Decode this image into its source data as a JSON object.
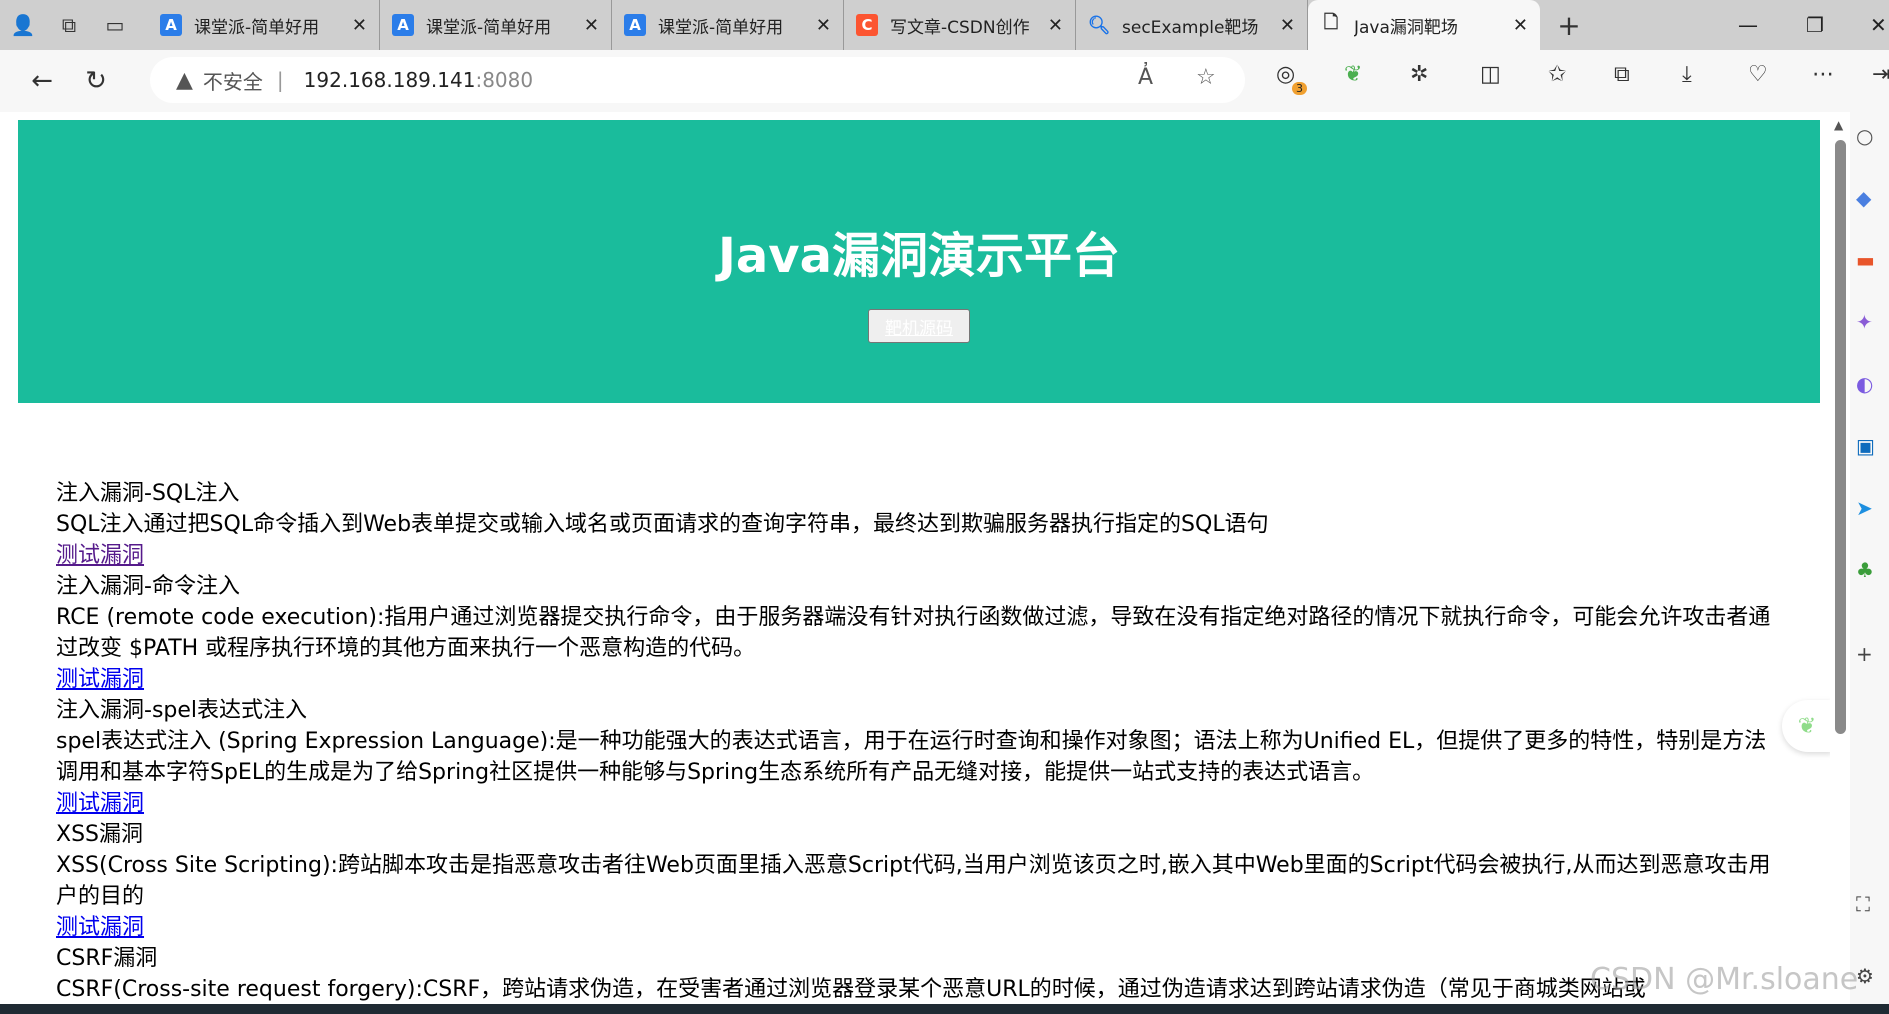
{
  "browser": {
    "tabs": [
      {
        "title": "课堂派-简单好用",
        "favicon": "A",
        "color": "#2b7de9"
      },
      {
        "title": "课堂派-简单好用",
        "favicon": "A",
        "color": "#2b7de9"
      },
      {
        "title": "课堂派-简单好用",
        "favicon": "A",
        "color": "#2b7de9"
      },
      {
        "title": "写文章-CSDN创作",
        "favicon": "C",
        "color": "#fc5531"
      },
      {
        "title": "secExample靶场",
        "favicon": "search-icon",
        "color": "#1a73e8"
      },
      {
        "title": "Java漏洞靶场",
        "favicon": "page-icon",
        "active": true
      }
    ],
    "address": {
      "security": "不安全",
      "host": "192.168.189.141",
      "port": ":8080"
    },
    "badge_count": "3"
  },
  "page": {
    "title": "Java漏洞演示平台",
    "source_button": "靶机源码",
    "sections": [
      {
        "title": "注入漏洞-SQL注入",
        "desc": "SQL注入通过把SQL命令插入到Web表单提交或输入域名或页面请求的查询字符串，最终达到欺骗服务器执行指定的SQL语句",
        "link": "测试漏洞"
      },
      {
        "title": "注入漏洞-命令注入",
        "desc": "RCE (remote code execution):指用户通过浏览器提交执行命令，由于服务器端没有针对执行函数做过滤，导致在没有指定绝对路径的情况下就执行命令，可能会允许攻击者通过改变 $PATH 或程序执行环境的其他方面来执行一个恶意构造的代码。",
        "link": "测试漏洞"
      },
      {
        "title": "注入漏洞-spel表达式注入",
        "desc": "spel表达式注入 (Spring Expression Language):是一种功能强大的表达式语言，用于在运行时查询和操作对象图；语法上称为Unified EL，但提供了更多的特性，特别是方法调用和基本字符SpEL的生成是为了给Spring社区提供一种能够与Spring生态系统所有产品无缝对接，能提供一站式支持的表达式语言。",
        "link": "测试漏洞"
      },
      {
        "title": "XSS漏洞",
        "desc": "XSS(Cross Site Scripting):跨站脚本攻击是指恶意攻击者往Web页面里插入恶意Script代码,当用户浏览该页之时,嵌入其中Web里面的Script代码会被执行,从而达到恶意攻击用户的目的",
        "link": "测试漏洞"
      },
      {
        "title": "CSRF漏洞",
        "desc": "CSRF(Cross-site request forgery):CSRF，跨站请求伪造，在受害者通过浏览器登录某个恶意URL的时候，通过伪造请求达到跨站请求伪造（常见于商城类网站或"
      }
    ]
  },
  "watermark": "CSDN @Mr.sloane"
}
